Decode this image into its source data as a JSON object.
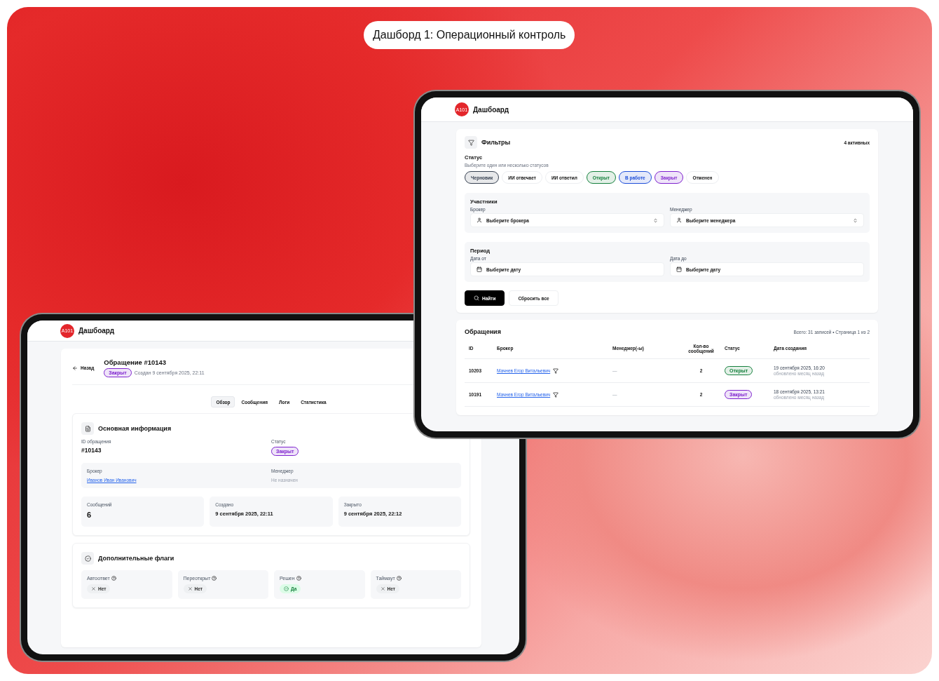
{
  "title_badge": "Дашборд 1: Операционный контроль",
  "filters_screen": {
    "app": {
      "logo": "A101",
      "name": "Дашбоард"
    },
    "filters": {
      "title": "Фильтры",
      "active_count": "4 активных",
      "status_label": "Статус",
      "status_hint": "Выберите один или несколько статусов",
      "statuses": [
        {
          "label": "Черновик",
          "selected": true,
          "color": "#374151"
        },
        {
          "label": "ИИ отвечает",
          "selected": false
        },
        {
          "label": "ИИ ответил",
          "selected": false
        },
        {
          "label": "Открыт",
          "selected": true,
          "color": "#15803d"
        },
        {
          "label": "В работе",
          "selected": true,
          "color": "#1d4ed8"
        },
        {
          "label": "Закрыт",
          "selected": true,
          "color": "#7e22ce"
        },
        {
          "label": "Отменен",
          "selected": false
        }
      ],
      "groups": [
        {
          "title": "Участники",
          "fields": [
            {
              "kind": "select",
              "label": "Брокер",
              "placeholder": "Выберите брокера"
            },
            {
              "kind": "select",
              "label": "Менеджер",
              "placeholder": "Выберите менеджера"
            }
          ]
        },
        {
          "title": "Период",
          "fields": [
            {
              "kind": "date",
              "label": "Дата от",
              "placeholder": "Выберите дату"
            },
            {
              "kind": "date",
              "label": "Дата до",
              "placeholder": "Выберите дату"
            }
          ]
        }
      ],
      "buttons": [
        {
          "label": "Найти",
          "kind": "primary"
        },
        {
          "label": "Сбросить все",
          "kind": "secondary"
        }
      ]
    },
    "table": {
      "title": "Обращения",
      "summary": "Всего: 31 записей • Страница 1 из 2",
      "columns": [
        "ID",
        "Брокер",
        "Менеджер(-ы)",
        "Кол-во сообщений",
        "Статус",
        "Дата создания"
      ],
      "rows": [
        {
          "id": "10203",
          "broker": "Мачнев Егор Витальевич",
          "manager": "—",
          "messages": "2",
          "status": {
            "label": "Открыт",
            "color": "#15803d"
          },
          "created": "19 сентября 2025, 16:20",
          "updated": "обновлено месяц назад"
        },
        {
          "id": "10191",
          "broker": "Мачнев Егор Витальевич",
          "manager": "—",
          "messages": "2",
          "status": {
            "label": "Закрыт",
            "color": "#7e22ce"
          },
          "created": "18 сентября 2025, 13:21",
          "updated": "обновлено месяц назад"
        }
      ]
    }
  },
  "ticket_screen": {
    "app": {
      "logo": "A101",
      "name": "Дашбоард"
    },
    "back": "Назад",
    "title": "Обращение #10143",
    "status": {
      "label": "Закрыт",
      "color": "#7e22ce"
    },
    "created": "Создан 9 сентября 2025, 22:11",
    "tabs": [
      {
        "label": "Обзор",
        "selected": true
      },
      {
        "label": "Сообщения",
        "selected": false
      },
      {
        "label": "Логи",
        "selected": false
      },
      {
        "label": "Статистика",
        "selected": false
      }
    ],
    "info": {
      "title": "Основная информация",
      "id_label": "ID обращения",
      "id": "#10143",
      "status_label": "Статус",
      "status": {
        "label": "Закрыт",
        "color": "#7e22ce"
      },
      "people": [
        {
          "label": "Брокер",
          "value": "Иванов Иван Иванович",
          "assigned": true
        },
        {
          "label": "Менеджер",
          "value": "Не назначен",
          "assigned": false
        }
      ],
      "stats": [
        {
          "label": "Сообщений",
          "value": "6",
          "kind": "count"
        },
        {
          "label": "Создано",
          "value": "9 сентября 2025, 22:11",
          "kind": "date"
        },
        {
          "label": "Закрыто",
          "value": "9 сентября 2025, 22:12",
          "kind": "date"
        }
      ]
    },
    "flags": {
      "title": "Дополнительные флаги",
      "items": [
        {
          "label": "Автоответ",
          "value": "Нет",
          "on": false
        },
        {
          "label": "Переоткрыт",
          "value": "Нет",
          "on": false
        },
        {
          "label": "Решен",
          "value": "Да",
          "on": true
        },
        {
          "label": "Таймаут",
          "value": "Нет",
          "on": false
        }
      ]
    }
  }
}
